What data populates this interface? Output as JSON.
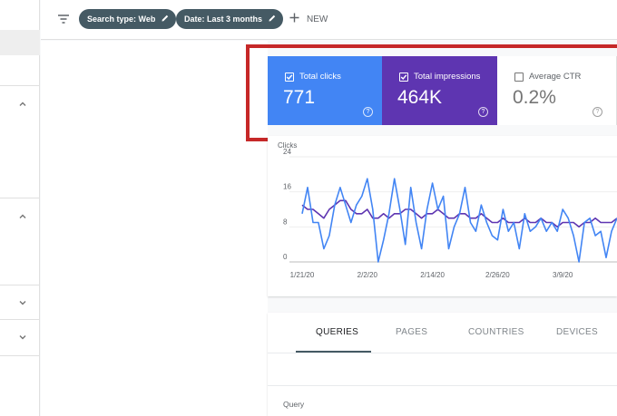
{
  "filters": {
    "chips": [
      {
        "label": "Search type: Web"
      },
      {
        "label": "Date: Last 3 months"
      }
    ],
    "new_label": "NEW"
  },
  "metrics": [
    {
      "label": "Total clicks",
      "value": "771",
      "checked": true,
      "color": "#4285f4"
    },
    {
      "label": "Total impressions",
      "value": "464K",
      "checked": true,
      "color": "#5e35b1"
    },
    {
      "label": "Average CTR",
      "value": "0.2%",
      "checked": false,
      "color": "#ffffff"
    }
  ],
  "chart_data": {
    "type": "line",
    "ylabel": "Clicks",
    "y_ticks": [
      "24",
      "16",
      "8",
      "0"
    ],
    "ylim": [
      0,
      24
    ],
    "x_ticks": [
      "1/21/20",
      "2/2/20",
      "2/14/20",
      "2/26/20",
      "3/9/20"
    ],
    "grid": true,
    "series": [
      {
        "name": "Total clicks",
        "color": "#4285f4",
        "values": [
          11,
          17,
          9,
          9,
          3,
          6,
          13,
          17,
          13,
          9,
          13,
          15,
          19,
          12,
          0,
          5,
          11,
          19,
          12,
          4,
          17,
          9,
          3,
          12,
          18,
          12,
          15,
          3,
          8,
          11,
          17,
          9,
          7,
          13,
          9,
          6,
          5,
          12,
          7,
          9,
          3,
          11,
          7,
          8,
          10,
          7,
          9,
          7,
          12,
          10,
          6,
          0,
          9,
          10,
          6,
          7,
          1,
          7,
          10
        ]
      },
      {
        "name": "Total impressions",
        "color": "#5e35b1",
        "values": [
          13,
          12,
          12,
          11,
          10,
          12,
          13,
          14,
          14,
          12,
          11,
          11,
          12,
          10,
          10,
          11,
          10,
          11,
          11,
          12,
          12,
          11,
          10,
          11,
          11,
          12,
          11,
          10,
          10,
          11,
          11,
          10,
          10,
          11,
          10,
          9,
          9,
          10,
          9,
          9,
          9,
          10,
          9,
          9,
          10,
          9,
          9,
          8,
          9,
          9,
          9,
          8,
          9,
          9,
          10,
          9,
          9,
          9,
          10
        ]
      }
    ]
  },
  "tabs": [
    "QUERIES",
    "PAGES",
    "COUNTRIES",
    "DEVICES"
  ],
  "table": {
    "query_header": "Query"
  },
  "highlight": {
    "color": "#c62828"
  }
}
